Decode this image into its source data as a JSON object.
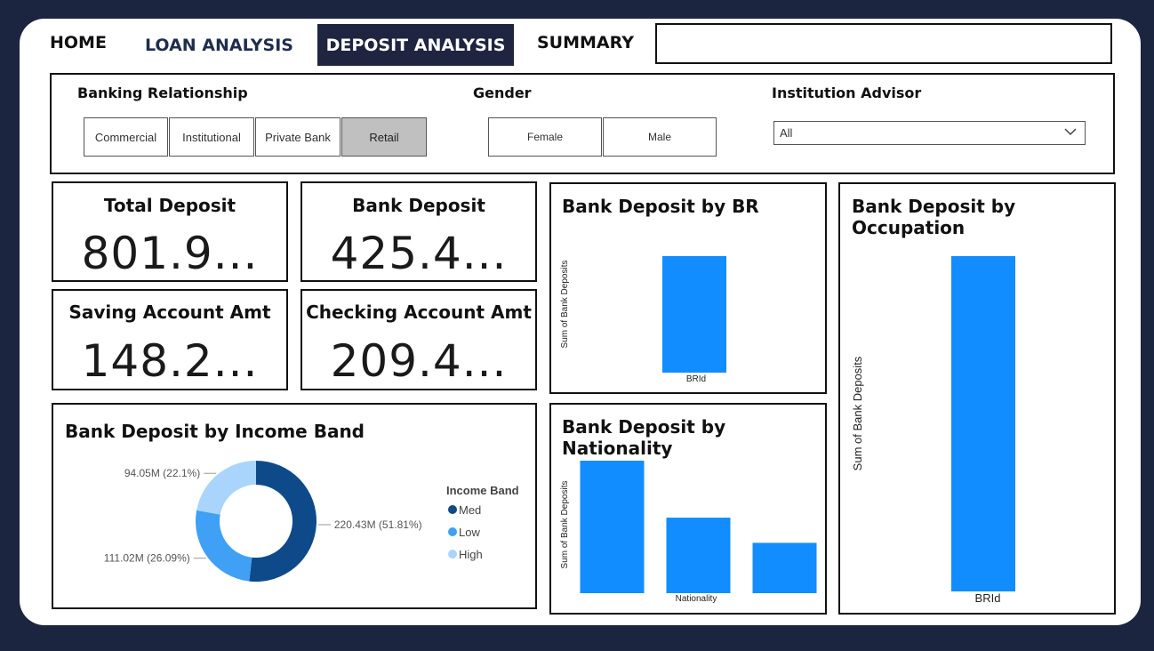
{
  "nav": {
    "home": "HOME",
    "loan_analysis": "LOAN ANALYSIS",
    "deposit_analysis": "DEPOSIT ANALYSIS",
    "summary": "SUMMARY"
  },
  "filters": {
    "banking_relationship": {
      "title": "Banking Relationship",
      "options": [
        "Commercial",
        "Institutional",
        "Private Bank",
        "Retail"
      ],
      "selected": "Retail"
    },
    "gender": {
      "title": "Gender",
      "options": [
        "Female",
        "Male"
      ]
    },
    "institution_advisor": {
      "title": "Institution Advisor",
      "value": "All"
    }
  },
  "kpis": {
    "total_deposit": {
      "title": "Total Deposit",
      "value": "801.9..."
    },
    "bank_deposit": {
      "title": "Bank Deposit",
      "value": "425.4..."
    },
    "saving_account": {
      "title": "Saving Account Amt",
      "value": "148.2..."
    },
    "checking_account": {
      "title": "Checking Account Amt",
      "value": "209.4..."
    }
  },
  "colors": {
    "bar": "#118dff",
    "med": "#0e4a8a",
    "low": "#3fa0f5",
    "high": "#a9d4fb",
    "nav_active_bg": "#1f2540"
  },
  "chart_data": [
    {
      "id": "bank_deposit_by_br",
      "type": "bar",
      "title": "Bank Deposit by BR",
      "xlabel": "BRId",
      "ylabel": "Sum of Bank Deposits",
      "categories": [
        ""
      ],
      "values": [
        1
      ]
    },
    {
      "id": "bank_deposit_by_occupation",
      "type": "bar",
      "title": "Bank Deposit by Occupation",
      "xlabel": "BRId",
      "ylabel": "Sum of Bank Deposits",
      "categories": [
        ""
      ],
      "values": [
        1
      ]
    },
    {
      "id": "bank_deposit_by_nationality",
      "type": "bar",
      "title": "Bank Deposit by Nationality",
      "xlabel": "Nationality",
      "ylabel": "Sum of Bank Deposits",
      "categories": [
        "",
        "",
        ""
      ],
      "values": [
        1,
        0.57,
        0.38
      ]
    },
    {
      "id": "bank_deposit_by_income_band",
      "type": "pie",
      "title": "Bank Deposit by Income Band",
      "legend_title": "Income Band",
      "slices": [
        {
          "label": "Med",
          "value": 220.43,
          "data_label": "220.43M (51.81%)"
        },
        {
          "label": "Low",
          "value": 111.02,
          "data_label": "111.02M (26.09%)"
        },
        {
          "label": "High",
          "value": 94.05,
          "data_label": "94.05M (22.1%)"
        }
      ]
    }
  ]
}
